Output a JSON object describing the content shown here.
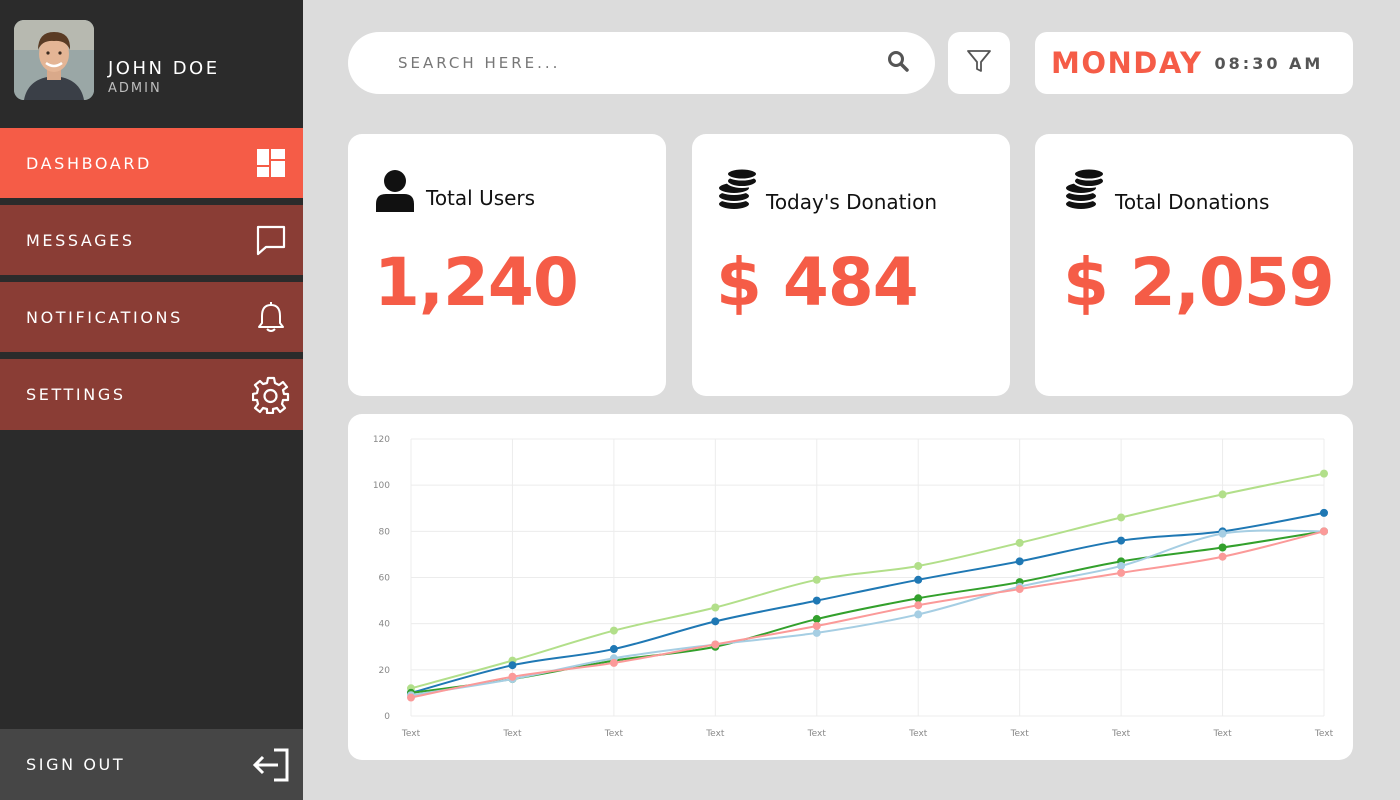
{
  "profile": {
    "name": "JOHN DOE",
    "role": "ADMIN"
  },
  "nav": {
    "dashboard": "DASHBOARD",
    "messages": "MESSAGES",
    "notifications": "NOTIFICATIONS",
    "settings": "SETTINGS",
    "signout": "SIGN OUT"
  },
  "search": {
    "placeholder": "SEARCH HERE..."
  },
  "clock": {
    "day": "MONDAY",
    "time": "08:30 AM"
  },
  "stats": {
    "total_users": {
      "label": "Total Users",
      "value": "1,240"
    },
    "todays_donation": {
      "label": "Today's Donation",
      "value": "$ 484"
    },
    "total_donations": {
      "label": "Total Donations",
      "value": "$ 2,059"
    }
  },
  "colors": {
    "accent": "#f55c47",
    "nav_muted": "#8a3d35",
    "sidebar": "#2b2b2b",
    "signout": "#464646",
    "background": "#dcdcdc"
  },
  "chart_data": {
    "type": "line",
    "title": "",
    "xlabel": "",
    "ylabel": "",
    "categories": [
      "Text",
      "Text",
      "Text",
      "Text",
      "Text",
      "Text",
      "Text",
      "Text",
      "Text",
      "Text"
    ],
    "ylim": [
      0,
      120
    ],
    "yticks": [
      "0",
      "20",
      "40",
      "60",
      "80",
      "100",
      "120"
    ],
    "grid": true,
    "legend": "none",
    "series": [
      {
        "color": "#b2df8a",
        "values": [
          12,
          24,
          37,
          47,
          59,
          65,
          75,
          86,
          96,
          105
        ]
      },
      {
        "color": "#1f78b4",
        "values": [
          10,
          22,
          29,
          41,
          50,
          59,
          67,
          76,
          80,
          88
        ]
      },
      {
        "color": "#33a02c",
        "values": [
          10,
          16,
          24,
          30,
          42,
          51,
          58,
          67,
          73,
          80
        ]
      },
      {
        "color": "#a6cee3",
        "values": [
          9,
          16,
          25,
          31,
          36,
          44,
          56,
          65,
          79,
          80
        ]
      },
      {
        "color": "#fb9a99",
        "values": [
          8,
          17,
          23,
          31,
          39,
          48,
          55,
          62,
          69,
          80
        ]
      }
    ]
  }
}
